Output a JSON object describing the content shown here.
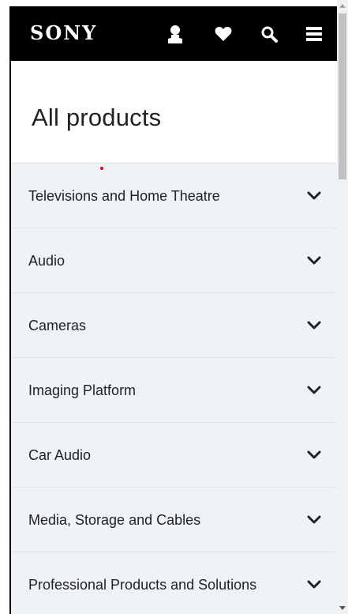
{
  "header": {
    "logo": "SONY",
    "icons": [
      "account-icon",
      "heart-icon",
      "search-icon",
      "menu-icon"
    ]
  },
  "page": {
    "title": "All products"
  },
  "categories": [
    {
      "label": "Televisions and Home Theatre"
    },
    {
      "label": "Audio"
    },
    {
      "label": "Cameras"
    },
    {
      "label": "Imaging Platform"
    },
    {
      "label": "Car Audio"
    },
    {
      "label": "Media, Storage and Cables"
    },
    {
      "label": "Professional Products and Solutions"
    }
  ],
  "colors": {
    "header_bg": "#000000",
    "list_bg": "#eff2f7",
    "accent_dot": "#e60012",
    "text": "#222222"
  }
}
